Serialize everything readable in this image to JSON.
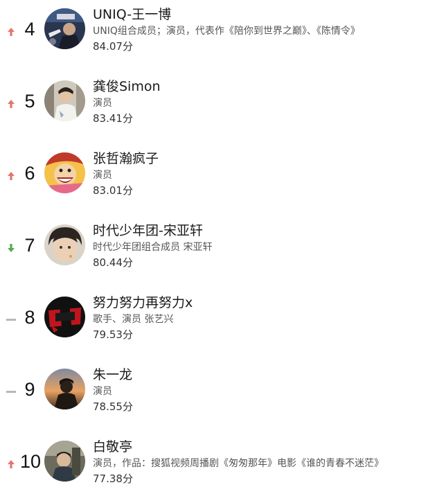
{
  "colors": {
    "up": "#e8746a",
    "down": "#5aaa50",
    "same": "#b8b8b8"
  },
  "items": [
    {
      "rank": "4",
      "trend": "up",
      "trend_icon": "up-arrow-icon",
      "name": "UNIQ-王一博",
      "desc": "UNIQ组合成员；演员，代表作《陪你到世界之巅》、《陈情令》",
      "score": "84.07分",
      "avatar_icon": "avatar-photo-icon"
    },
    {
      "rank": "5",
      "trend": "up",
      "trend_icon": "up-arrow-icon",
      "name": "龚俊Simon",
      "desc": "演员",
      "score": "83.41分",
      "avatar_icon": "avatar-photo-icon"
    },
    {
      "rank": "6",
      "trend": "up",
      "trend_icon": "up-arrow-icon",
      "name": "张哲瀚疯子",
      "desc": "演员",
      "score": "83.01分",
      "avatar_icon": "avatar-cartoon-icon"
    },
    {
      "rank": "7",
      "trend": "down",
      "trend_icon": "down-arrow-icon",
      "name": "时代少年团-宋亚轩",
      "desc": "时代少年团组合成员 宋亚轩",
      "score": "80.44分",
      "avatar_icon": "avatar-photo-icon"
    },
    {
      "rank": "8",
      "trend": "same",
      "trend_icon": "dash-icon",
      "name": "努力努力再努力x",
      "desc": "歌手、演员 张艺兴",
      "score": "79.53分",
      "avatar_icon": "avatar-logo-icon"
    },
    {
      "rank": "9",
      "trend": "same",
      "trend_icon": "dash-icon",
      "name": "朱一龙",
      "desc": "演员",
      "score": "78.55分",
      "avatar_icon": "avatar-photo-icon"
    },
    {
      "rank": "10",
      "trend": "up",
      "trend_icon": "up-arrow-icon",
      "name": "白敬亭",
      "desc": "演员，作品：搜狐视频周播剧《匆匆那年》电影《谁的青春不迷茫》",
      "score": "77.38分",
      "avatar_icon": "avatar-photo-icon"
    }
  ]
}
